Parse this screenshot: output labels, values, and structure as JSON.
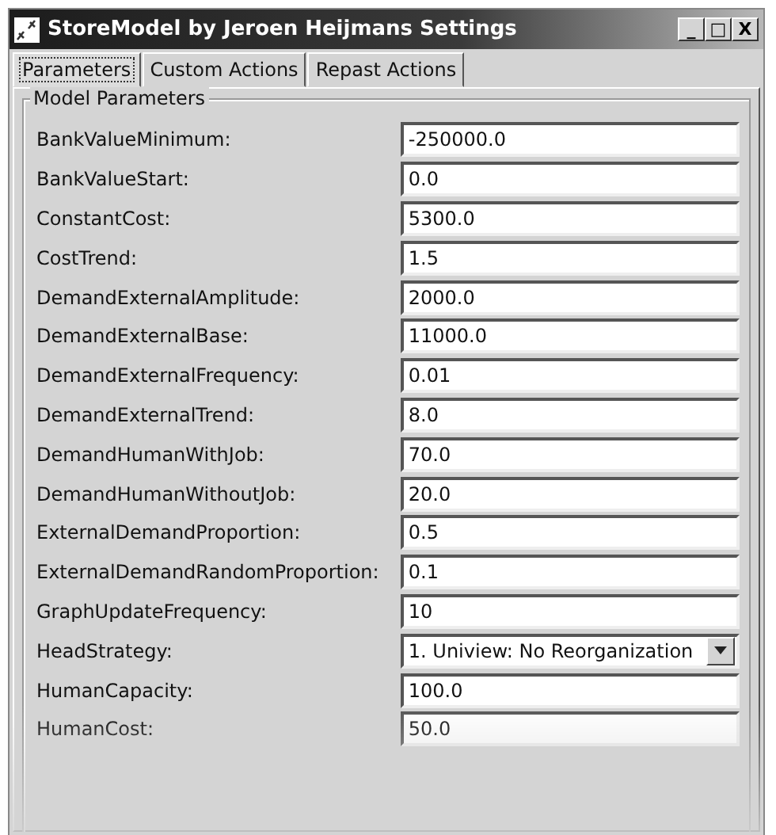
{
  "window": {
    "title": "StoreModel by Jeroen Heijmans Settings",
    "controls": [
      "_",
      "□",
      "X"
    ]
  },
  "tabs": [
    {
      "label": "Parameters",
      "selected": true
    },
    {
      "label": "Custom Actions",
      "selected": false
    },
    {
      "label": "Repast Actions",
      "selected": false
    }
  ],
  "group": {
    "title": "Model Parameters"
  },
  "parameters": [
    {
      "kind": "text",
      "label": "BankValueMinimum:",
      "value": "-250000.0"
    },
    {
      "kind": "text",
      "label": "BankValueStart:",
      "value": "0.0"
    },
    {
      "kind": "text",
      "label": "ConstantCost:",
      "value": "5300.0"
    },
    {
      "kind": "text",
      "label": "CostTrend:",
      "value": "1.5"
    },
    {
      "kind": "text",
      "label": "DemandExternalAmplitude:",
      "value": "2000.0"
    },
    {
      "kind": "text",
      "label": "DemandExternalBase:",
      "value": "11000.0"
    },
    {
      "kind": "text",
      "label": "DemandExternalFrequency:",
      "value": "0.01"
    },
    {
      "kind": "text",
      "label": "DemandExternalTrend:",
      "value": "8.0"
    },
    {
      "kind": "text",
      "label": "DemandHumanWithJob:",
      "value": "70.0"
    },
    {
      "kind": "text",
      "label": "DemandHumanWithoutJob:",
      "value": "20.0"
    },
    {
      "kind": "text",
      "label": "ExternalDemandProportion:",
      "value": "0.5"
    },
    {
      "kind": "text",
      "label": "ExternalDemandRandomProportion:",
      "value": "0.1"
    },
    {
      "kind": "text",
      "label": "GraphUpdateFrequency:",
      "value": "10"
    },
    {
      "kind": "combo",
      "label": "HeadStrategy:",
      "value": "1. Uniview: No Reorganization"
    },
    {
      "kind": "text",
      "label": "HumanCapacity:",
      "value": "100.0"
    },
    {
      "kind": "text",
      "label": "HumanCost:",
      "value": "50.0"
    }
  ]
}
